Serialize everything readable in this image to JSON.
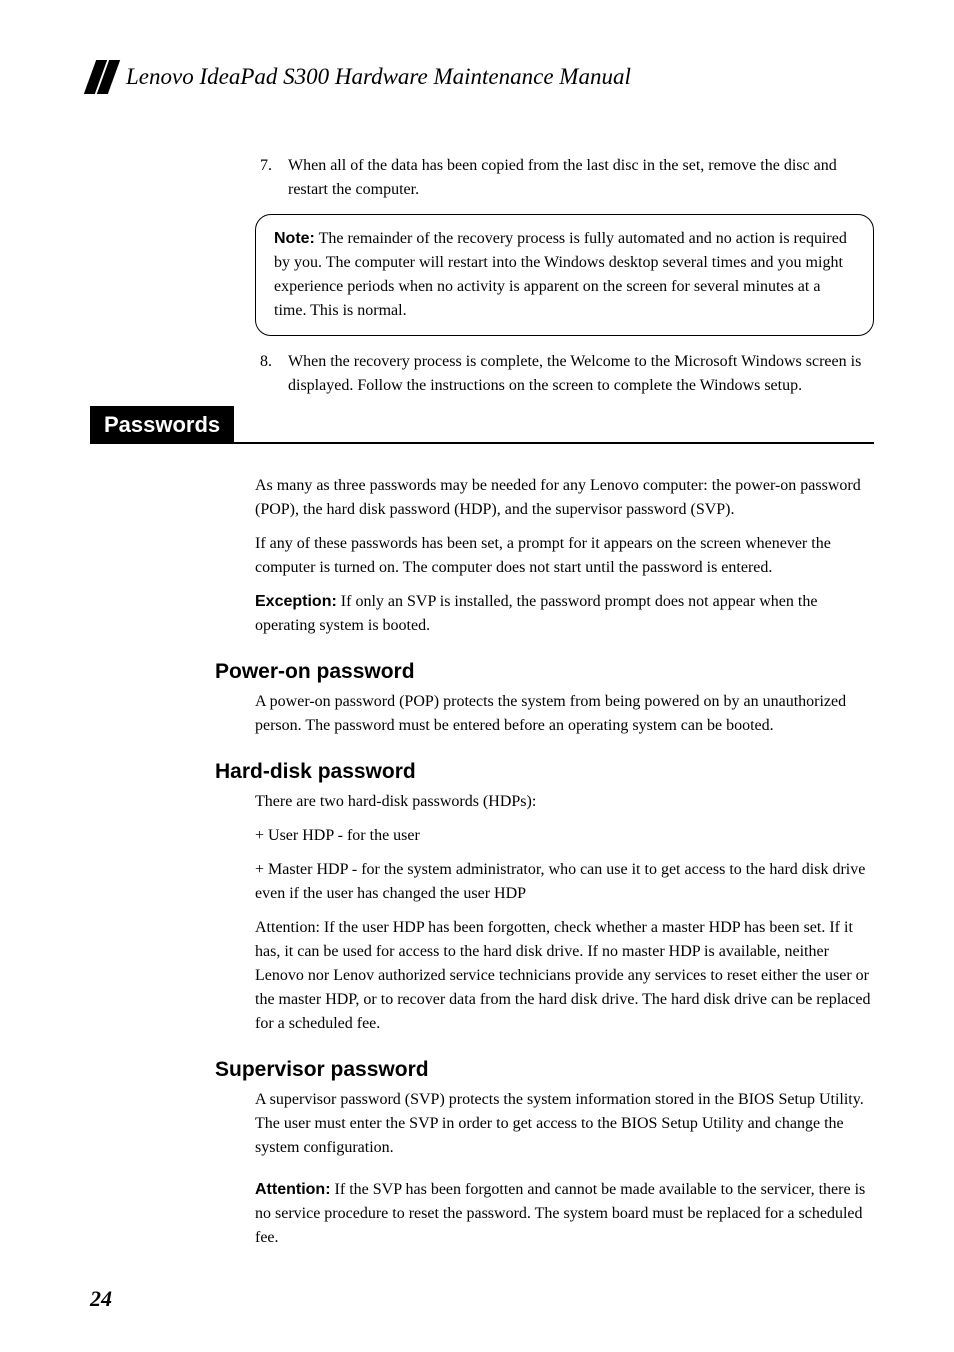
{
  "docTitle": "Lenovo IdeaPad S300 Hardware Maintenance Manual",
  "item7": {
    "num": "7.",
    "text": "When all of the data has been copied from the last disc in the set, remove the disc and restart the computer."
  },
  "noteLabel": "Note:",
  "noteText": " The remainder of the recovery process is fully automated and no action is required by you. The computer will restart into the Windows desktop several times and you might experience periods when no activity is apparent on the screen for several minutes at a time. This is normal.",
  "item8": {
    "num": "8.",
    "text": "When the recovery process is complete, the Welcome to the Microsoft Windows screen is displayed. Follow the instructions on the screen to complete the Windows setup."
  },
  "passwordsLabel": "Passwords",
  "pwIntro1": "As many as three passwords may be needed for any Lenovo computer: the power-on password (POP), the hard disk password (HDP), and the supervisor password (SVP).",
  "pwIntro2": "If any of these passwords has been set, a prompt for it appears on the screen whenever the computer is turned on. The computer does not start until the password is entered.",
  "exceptionLabel": "Exception:",
  "exceptionText": " If only an SVP is installed, the password prompt does not appear when the operating system is booted.",
  "powerOn": {
    "heading": "Power-on password",
    "text": "A power-on password (POP) protects the system from being powered on by an unauthorized person. The password must be entered before an operating system can be booted."
  },
  "hardDisk": {
    "heading": "Hard-disk password",
    "p1": "There are two hard-disk passwords (HDPs):",
    "p2": "+ User HDP - for the user",
    "p3": "+ Master HDP - for the system administrator, who can use it to get access to the hard disk drive even if the user has changed the user HDP",
    "p4": "Attention: If the user HDP has been forgotten, check whether a master HDP has been set. If it has, it can be used for access to the hard disk drive. If no master HDP is available, neither Lenovo nor Lenov authorized service technicians provide any services to reset either the user or the master HDP, or to recover data from the hard disk drive. The hard disk drive can be replaced for a scheduled fee."
  },
  "supervisor": {
    "heading": "Supervisor password",
    "p1": "A supervisor password (SVP) protects the system information stored in the BIOS Setup Utility. The user must enter the SVP in order to get access to the BIOS Setup Utility and change the system configuration.",
    "attentionLabel": "Attention:",
    "attentionText": " If the SVP has been forgotten and cannot be made available to the servicer, there is no service procedure to reset the password. The system board must be replaced for a scheduled fee."
  },
  "pageNum": "24"
}
